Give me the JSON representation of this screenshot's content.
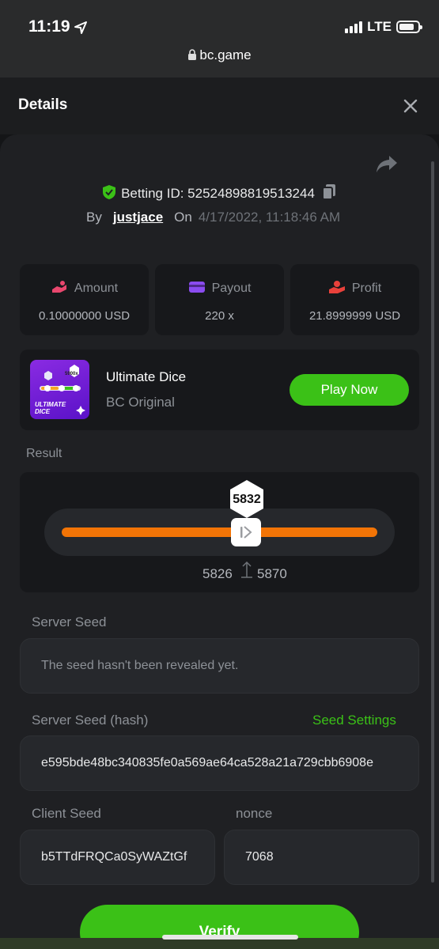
{
  "status": {
    "time": "11:19",
    "network": "LTE"
  },
  "browser": {
    "url": "bc.game"
  },
  "header": {
    "title": "Details"
  },
  "bet": {
    "id_label": "Betting ID: 52524898819513244",
    "by_label": "By",
    "user": "justjace",
    "on_label": "On",
    "date": "4/17/2022, 11:18:46 AM"
  },
  "stats": [
    {
      "label": "Amount",
      "value": "0.10000000 USD",
      "icon": "money-hand-icon",
      "color": "#e9476e"
    },
    {
      "label": "Payout",
      "value": "220 x",
      "icon": "card-icon",
      "color": "#8b4cf0"
    },
    {
      "label": "Profit",
      "value": "21.8999999 USD",
      "icon": "profit-hand-icon",
      "color": "#e9413b"
    }
  ],
  "game": {
    "thumb_text": "ULTIMATE DICE",
    "thumb_badge": "5900x",
    "name": "Ultimate Dice",
    "provider": "BC Original",
    "play_label": "Play Now"
  },
  "result": {
    "label": "Result",
    "value": "5832",
    "range_low": "5826",
    "range_high": "5870",
    "accent": "#f27406"
  },
  "seeds": {
    "server_label": "Server Seed",
    "server_value": "The seed hasn't been revealed yet.",
    "hash_label": "Server Seed (hash)",
    "settings_label": "Seed Settings",
    "hash_value": "e595bde48bc340835fe0a569ae64ca528a21a729cbb6908e",
    "client_label": "Client Seed",
    "client_value": "b5TTdFRQCa0SyWAZtGf",
    "nonce_label": "nonce",
    "nonce_value": "7068"
  },
  "verify_label": "Verify",
  "colors": {
    "accent": "#3bc117",
    "background": "#1f2023",
    "card": "#17181b"
  }
}
